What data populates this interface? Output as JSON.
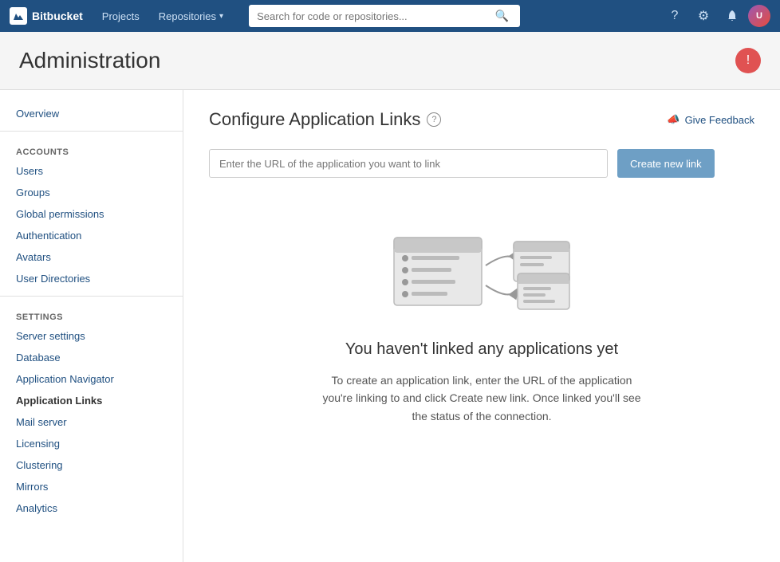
{
  "topnav": {
    "logo_text": "Bitbucket",
    "logo_icon": "B",
    "links": [
      {
        "label": "Projects",
        "id": "projects"
      },
      {
        "label": "Repositories",
        "id": "repositories",
        "has_dropdown": true
      }
    ],
    "search_placeholder": "Search for code or repositories...",
    "icons": {
      "help": "?",
      "settings": "⚙",
      "notifications": "🔔"
    },
    "avatar_initials": "U"
  },
  "page_header": {
    "title": "Administration",
    "alert_icon": "!"
  },
  "sidebar": {
    "overview": "Overview",
    "accounts_section": "ACCOUNTS",
    "accounts_links": [
      {
        "label": "Users",
        "id": "users"
      },
      {
        "label": "Groups",
        "id": "groups"
      },
      {
        "label": "Global permissions",
        "id": "global-permissions"
      },
      {
        "label": "Authentication",
        "id": "authentication"
      },
      {
        "label": "Avatars",
        "id": "avatars"
      },
      {
        "label": "User Directories",
        "id": "user-directories"
      }
    ],
    "settings_section": "SETTINGS",
    "settings_links": [
      {
        "label": "Server settings",
        "id": "server-settings"
      },
      {
        "label": "Database",
        "id": "database"
      },
      {
        "label": "Application Navigator",
        "id": "application-navigator"
      },
      {
        "label": "Application Links",
        "id": "application-links",
        "active": true
      },
      {
        "label": "Mail server",
        "id": "mail-server"
      },
      {
        "label": "Licensing",
        "id": "licensing"
      },
      {
        "label": "Clustering",
        "id": "clustering"
      },
      {
        "label": "Mirrors",
        "id": "mirrors"
      },
      {
        "label": "Analytics",
        "id": "analytics"
      }
    ]
  },
  "main": {
    "title": "Configure Application Links",
    "help_icon": "?",
    "feedback_label": "Give Feedback",
    "feedback_icon": "📣",
    "url_placeholder": "Enter the URL of the application you want to link",
    "create_button_label": "Create new link",
    "empty_state": {
      "heading": "You haven't linked any applications yet",
      "description": "To create an application link, enter the URL of the application you're linking to and click Create new link. Once linked you'll see the status of the connection."
    }
  }
}
